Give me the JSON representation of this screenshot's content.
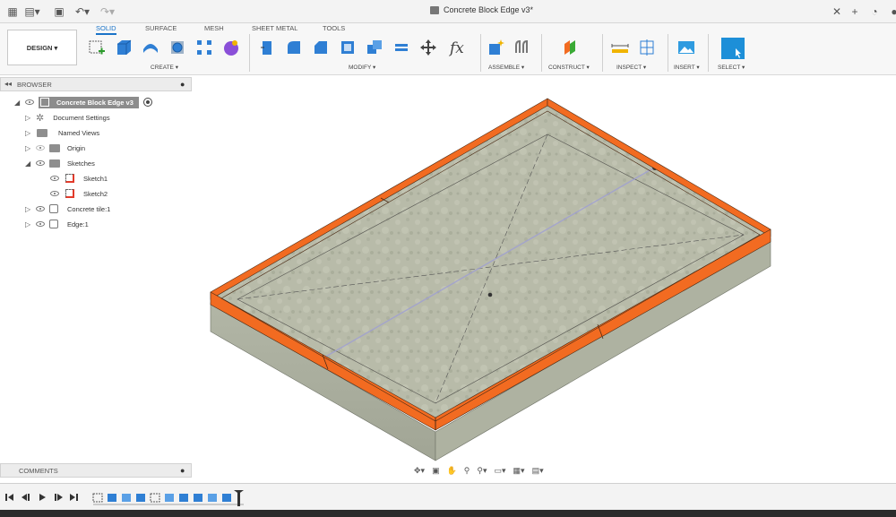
{
  "window": {
    "document_title": "Concrete Block Edge v3*"
  },
  "ribbon": {
    "tabs": [
      "SOLID",
      "SURFACE",
      "MESH",
      "SHEET METAL",
      "TOOLS"
    ],
    "active_tab": "SOLID",
    "workspace": "DESIGN ▾",
    "groups": [
      "CREATE ▾",
      "MODIFY ▾",
      "ASSEMBLE ▾",
      "CONSTRUCT ▾",
      "INSPECT ▾",
      "INSERT ▾",
      "SELECT ▾"
    ],
    "fx_label": "fx"
  },
  "browser": {
    "title": "BROWSER",
    "root": "Concrete Block Edge v3",
    "items": [
      {
        "label": "Document Settings"
      },
      {
        "label": "Named Views"
      },
      {
        "label": "Origin"
      },
      {
        "label": "Sketches"
      },
      {
        "label": "Sketch1"
      },
      {
        "label": "Sketch2"
      },
      {
        "label": "Concrete tile:1"
      },
      {
        "label": "Edge:1"
      }
    ]
  },
  "comments": {
    "title": "COMMENTS"
  },
  "colors": {
    "accent": "#1a73c8",
    "edge_orange": "#f26b21",
    "concrete": "#b4b8a7",
    "select_blue": "#1d8fd8"
  }
}
